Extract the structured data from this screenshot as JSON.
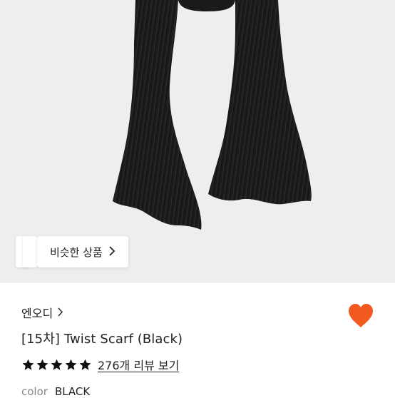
{
  "product_image": {
    "subject": "scarf-image",
    "background": "#eeeeee"
  },
  "similar": {
    "label": "비슷한 상품",
    "icon": "chevron-right-icon"
  },
  "brand": {
    "name": "엔오디",
    "icon": "chevron-right-icon"
  },
  "wishlist": {
    "icon": "heart-icon",
    "color": "#f25a1f",
    "state": "filled"
  },
  "product": {
    "title": "[15차] Twist Scarf (Black)"
  },
  "rating": {
    "stars": 5,
    "max": 5,
    "review_link": "276개 리뷰 보기"
  },
  "option": {
    "label": "color",
    "value": "BLACK"
  }
}
